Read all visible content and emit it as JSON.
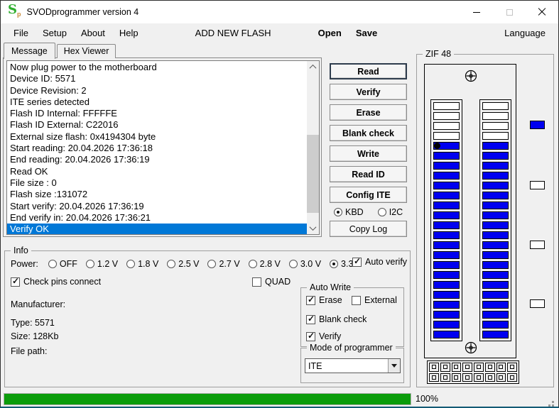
{
  "window": {
    "title": "SVODprogrammer version 4",
    "icon_letter": "S",
    "icon_sub": "p"
  },
  "menu": {
    "items": [
      "File",
      "Setup",
      "About",
      "Help",
      "ADD NEW FLASH",
      "Open",
      "Save",
      "Language"
    ]
  },
  "tabs": [
    {
      "label": "Message",
      "active": true
    },
    {
      "label": "Hex Viewer",
      "active": false
    }
  ],
  "log": {
    "lines": [
      "Now plug power to the motherboard",
      "Device ID: 5571",
      "Device Revision: 2",
      "ITE series detected",
      "Flash ID Internal: FFFFFE",
      "Flash ID External: C22016",
      "External size flash: 0x4194304 byte",
      "Start reading: 20.04.2026 17:36:18",
      "End reading: 20.04.2026 17:36:19",
      "Read OK",
      "File size : 0",
      "Flash size :131072",
      "Start verify: 20.04.2026 17:36:19",
      "End verify in: 20.04.2026 17:36:21",
      "Verify OK"
    ],
    "selected_index": 14,
    "selection_color": "#0078d7"
  },
  "actions": {
    "buttons": [
      {
        "label": "Read",
        "default": true
      },
      {
        "label": "Verify",
        "default": false
      },
      {
        "label": "Erase",
        "default": false
      },
      {
        "label": "Blank check",
        "default": false
      },
      {
        "label": "Write",
        "default": false
      },
      {
        "label": "Read ID",
        "default": false
      },
      {
        "label": "Config ITE",
        "default": false
      }
    ],
    "bus_options": [
      "KBD",
      "I2C"
    ],
    "bus_selected": "KBD",
    "copy_log_label": "Copy Log"
  },
  "zif": {
    "label": "ZIF 48",
    "columns": 2,
    "slots_per_column": 24,
    "empty_top_slots": 4,
    "pin1_slot": 5,
    "pin_color": "#0000f0",
    "indicators": [
      "#0000f0",
      "#ffffff",
      "#ffffff",
      "#ffffff"
    ],
    "connector_rows": 2,
    "connector_cols": 8
  },
  "info": {
    "label": "Info",
    "power_label": "Power:",
    "power_options": [
      "OFF",
      "1.2 V",
      "1.8 V",
      "2.5 V",
      "2.7 V",
      "2.8 V",
      "3.0 V",
      "3.3 V"
    ],
    "power_selected": "3.3 V",
    "auto_verify": {
      "label": "Auto verify",
      "checked": true
    },
    "check_pins": {
      "label": "Check pins connect",
      "checked": true
    },
    "quad": {
      "label": "QUAD",
      "checked": false
    },
    "fields": [
      "Manufacturer:",
      "Type: 5571",
      "Size: 128Kb",
      "File path:"
    ]
  },
  "auto_write": {
    "label": "Auto Write",
    "checkboxes": [
      {
        "label": "Erase",
        "checked": true
      },
      {
        "label": "External",
        "checked": false
      },
      {
        "label": "Blank check",
        "checked": true
      },
      {
        "label": "Verify",
        "checked": true
      }
    ]
  },
  "mode": {
    "label": "Mode of programmer",
    "value": "ITE"
  },
  "statusbar": {
    "progress_percent": 100,
    "progress_label": "100%",
    "progress_color": "#0b9c0b"
  }
}
